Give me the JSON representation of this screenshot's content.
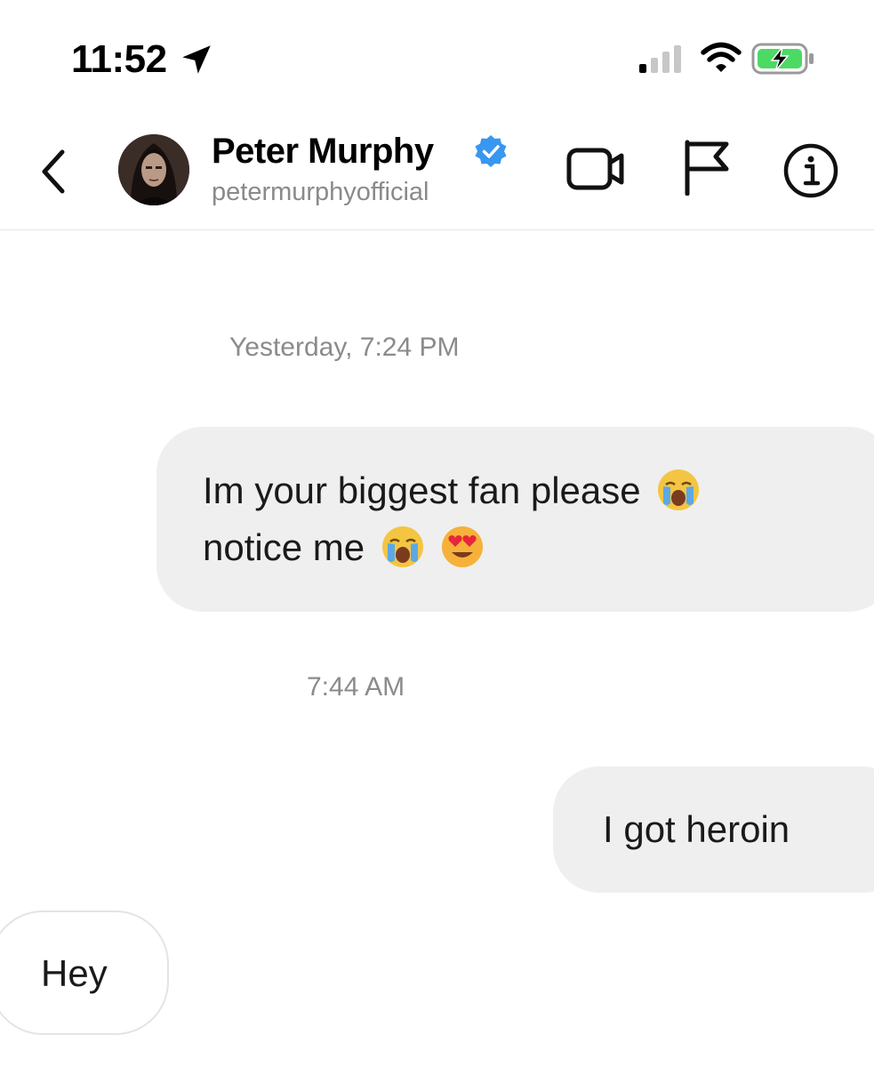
{
  "status_bar": {
    "time": "11:52",
    "icons": [
      "location-arrow-icon",
      "cellular-signal-icon",
      "wifi-icon",
      "battery-charging-icon"
    ],
    "battery_color": "#4cd964"
  },
  "header": {
    "contact_name": "Peter Murphy",
    "handle": "petermurphyofficial",
    "verified": true,
    "verified_color": "#3897f0",
    "actions": [
      "video-call-icon",
      "flag-icon",
      "info-icon"
    ]
  },
  "thread": {
    "timestamps": [
      "Yesterday, 7:24 PM",
      "7:44 AM"
    ],
    "messages": [
      {
        "line1": "Im your biggest fan please",
        "line2": "notice me",
        "emojis": [
          "loudly-crying-emoji",
          "loudly-crying-emoji",
          "heart-eyes-emoji"
        ]
      },
      {
        "text": "I got heroin"
      },
      {
        "text": "Hey"
      }
    ]
  }
}
